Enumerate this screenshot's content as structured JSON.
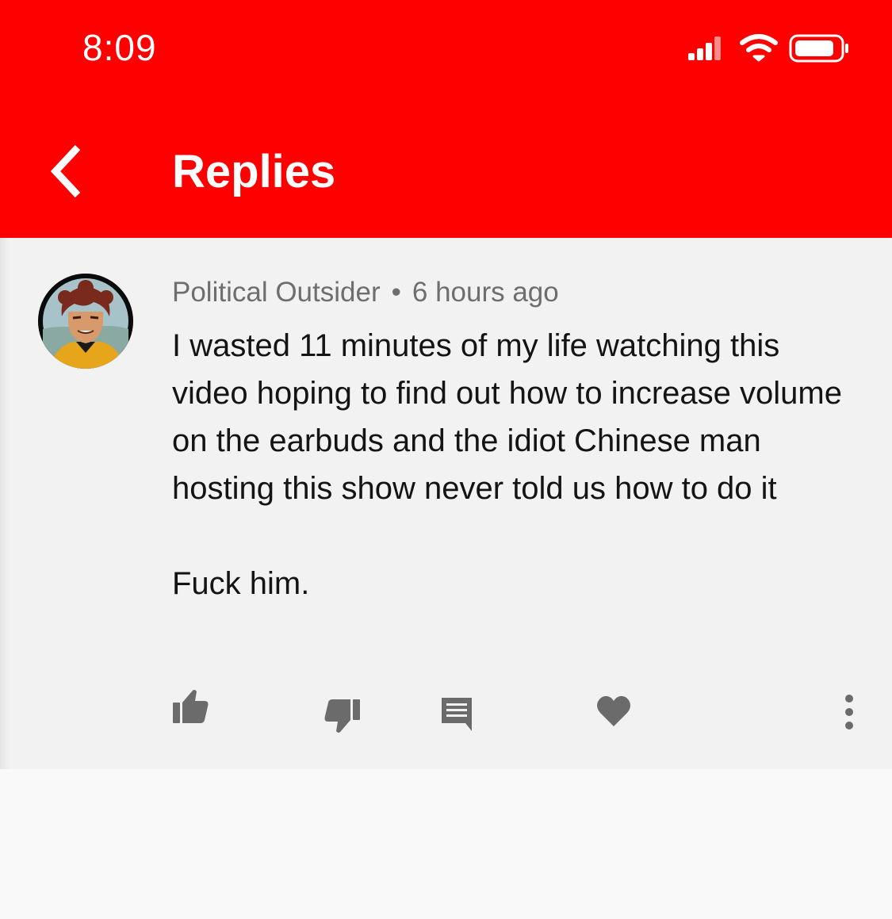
{
  "status_bar": {
    "time": "8:09",
    "icons": [
      "signal-icon",
      "wifi-icon",
      "battery-icon"
    ]
  },
  "header": {
    "title": "Replies",
    "back_icon": "chevron-left-icon"
  },
  "comment": {
    "author": "Political Outsider",
    "separator": "•",
    "timestamp": "6 hours ago",
    "text_paragraph_1": "I wasted 11 minutes of my life watching this video hoping to find out how to increase volume on the earbuds and the idiot Chinese man hosting this show never told us how to do it",
    "text_paragraph_2": "Fuck him.",
    "actions": [
      "thumbs-up-icon",
      "thumbs-down-icon",
      "reply-icon",
      "heart-icon",
      "more-vertical-icon"
    ]
  },
  "colors": {
    "header_bg": "#fe0000",
    "card_bg": "#f2f2f2",
    "page_bg": "#f9f9f9",
    "meta_text": "#6e6e6e",
    "body_text": "#141414",
    "icon_gray": "#6b6b6b"
  }
}
